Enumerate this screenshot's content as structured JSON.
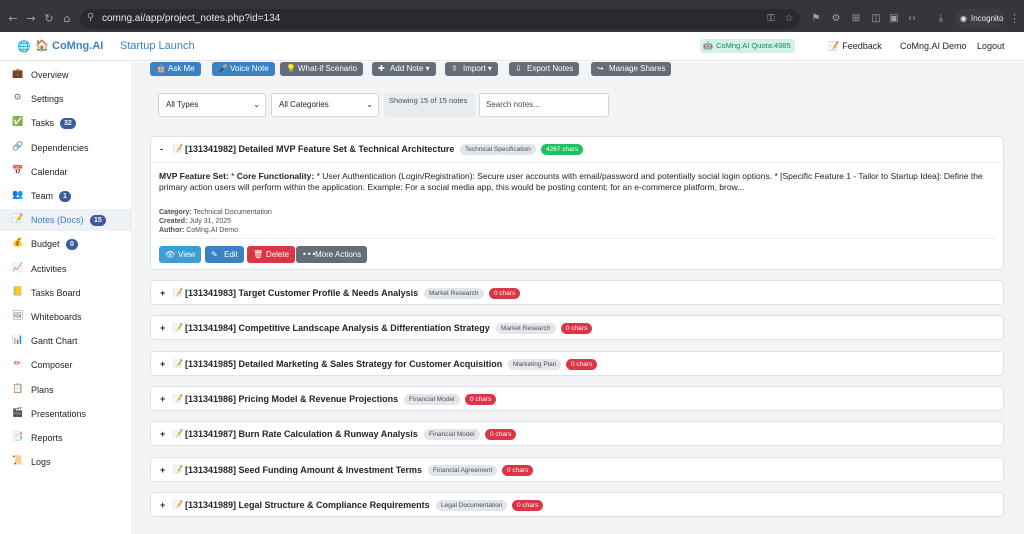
{
  "browser": {
    "url": "comng.ai/app/project_notes.php?id=134",
    "incognito_label": "Incognito"
  },
  "header": {
    "brand": "CoMng.AI",
    "project": "Startup Launch",
    "quota": "CoMng.AI Quota:4985",
    "feedback": "Feedback",
    "user": "CoMng.AI Demo",
    "logout": "Logout"
  },
  "sidebar": {
    "items": [
      {
        "label": "Overview",
        "icon": "briefcase-icon",
        "glyph": "💼",
        "color": "#7b4a2a"
      },
      {
        "label": "Settings",
        "icon": "gear-icon",
        "glyph": "⚙",
        "color": "#6c757d"
      },
      {
        "label": "Tasks",
        "icon": "check-icon",
        "glyph": "✅",
        "color": "#28a745",
        "badge": "32"
      },
      {
        "label": "Dependencies",
        "icon": "link-icon",
        "glyph": "🔗",
        "color": "#3b82c4"
      },
      {
        "label": "Calendar",
        "icon": "calendar-icon",
        "glyph": "📅",
        "color": "#3b82c4"
      },
      {
        "label": "Team",
        "icon": "team-icon",
        "glyph": "👥",
        "color": "#3d5a9e",
        "badge": "1"
      },
      {
        "label": "Notes (Docs)",
        "icon": "note-icon",
        "glyph": "📝",
        "color": "#c0392b",
        "badge": "15",
        "active": true
      },
      {
        "label": "Budget",
        "icon": "money-icon",
        "glyph": "💰",
        "color": "#d4a017",
        "badge": "0"
      },
      {
        "label": "Activities",
        "icon": "chart-icon",
        "glyph": "📈",
        "color": "#3b82c4"
      },
      {
        "label": "Tasks Board",
        "icon": "board-icon",
        "glyph": "📒",
        "color": "#e0b000"
      },
      {
        "label": "Whiteboards",
        "icon": "whiteboard-icon",
        "glyph": "🖼",
        "color": "#5a7d5a"
      },
      {
        "label": "Gantt Chart",
        "icon": "gantt-icon",
        "glyph": "📊",
        "color": "#3b82c4"
      },
      {
        "label": "Composer",
        "icon": "composer-icon",
        "glyph": "✏",
        "color": "#c0392b"
      },
      {
        "label": "Plans",
        "icon": "plans-icon",
        "glyph": "📋",
        "color": "#c0392b"
      },
      {
        "label": "Presentations",
        "icon": "presentation-icon",
        "glyph": "🎬",
        "color": "#3d3d5c"
      },
      {
        "label": "Reports",
        "icon": "report-icon",
        "glyph": "📑",
        "color": "#8a6d8a"
      },
      {
        "label": "Logs",
        "icon": "logs-icon",
        "glyph": "📜",
        "color": "#c08a2a"
      }
    ]
  },
  "toolbar": {
    "buttons": [
      {
        "label": "Ask Me",
        "icon": "robot-icon",
        "glyph": "🤖",
        "style": "blue"
      },
      {
        "label": "Voice Note",
        "icon": "mic-icon",
        "glyph": "🎤",
        "style": "blue"
      },
      {
        "label": "What-if Scenario",
        "icon": "bulb-icon",
        "glyph": "💡",
        "style": "gray"
      },
      {
        "label": "Add Note ▾",
        "icon": "plus-icon",
        "glyph": "✚",
        "style": "gray"
      },
      {
        "label": "Import ▾",
        "icon": "upload-icon",
        "glyph": "⇪",
        "style": "gray"
      },
      {
        "label": "Export Notes",
        "icon": "download-icon",
        "glyph": "⇩",
        "style": "gray"
      },
      {
        "label": "Manage Shares",
        "icon": "share-icon",
        "glyph": "↪",
        "style": "gray"
      }
    ]
  },
  "filters": {
    "types": "All Types",
    "categories": "All Categories",
    "showing": "Showing 15 of 15 notes",
    "search_placeholder": "Search notes..."
  },
  "expanded_note": {
    "toggle": "-",
    "title": "[131341982] Detailed MVP Feature Set & Technical Architecture",
    "type": "Technical Specification",
    "chars": "4267 chars",
    "body_bold1": "MVP Feature Set:",
    "body_mid1": " * ",
    "body_bold2": "Core Functionality:",
    "body_rest": " * User Authentication (Login/Registration): Secure user accounts with email/password and potentially social login options. * [Specific Feature 1 - Tailor to Startup Idea]: Define the primary action users will perform within the application. Example: For a social media app, this would be posting content; for an e-commerce platform, brow...",
    "category_label": "Category:",
    "category": "Technical Documentation",
    "created_label": "Created:",
    "created": "July 31, 2025",
    "author_label": "Author:",
    "author": "CoMng.AI Demo",
    "actions": {
      "view": "View",
      "edit": "Edit",
      "delete": "Delete",
      "more": "More Actions"
    }
  },
  "notes": [
    {
      "title": "[131341983] Target Customer Profile & Needs Analysis",
      "type": "Market Research",
      "chars": "0 chars"
    },
    {
      "title": "[131341984] Competitive Landscape Analysis & Differentiation Strategy",
      "type": "Market Research",
      "chars": "0 chars"
    },
    {
      "title": "[131341985] Detailed Marketing & Sales Strategy for Customer Acquisition",
      "type": "Marketing Plan",
      "chars": "0 chars"
    },
    {
      "title": "[131341986] Pricing Model & Revenue Projections",
      "type": "Financial Model",
      "chars": "0 chars"
    },
    {
      "title": "[131341987] Burn Rate Calculation & Runway Analysis",
      "type": "Financial Model",
      "chars": "0 chars"
    },
    {
      "title": "[131341988] Seed Funding Amount & Investment Terms",
      "type": "Financial Agreement",
      "chars": "0 chars"
    },
    {
      "title": "[131341989] Legal Structure & Compliance Requirements",
      "type": "Legal Documentation",
      "chars": "0 chars"
    }
  ]
}
